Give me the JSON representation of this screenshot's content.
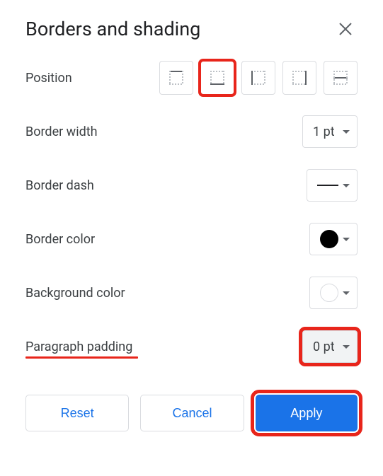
{
  "dialog": {
    "title": "Borders and shading"
  },
  "labels": {
    "position": "Position",
    "border_width": "Border width",
    "border_dash": "Border dash",
    "border_color": "Border color",
    "background_color": "Background color",
    "paragraph_padding": "Paragraph padding"
  },
  "position_options": [
    {
      "name": "top",
      "highlighted": false
    },
    {
      "name": "bottom",
      "highlighted": true
    },
    {
      "name": "left",
      "highlighted": false
    },
    {
      "name": "right",
      "highlighted": false
    },
    {
      "name": "between",
      "highlighted": false
    }
  ],
  "values": {
    "border_width": "1 pt",
    "border_dash": "solid",
    "border_color": "#000000",
    "background_color": "#ffffff",
    "paragraph_padding": "0 pt"
  },
  "buttons": {
    "reset": "Reset",
    "cancel": "Cancel",
    "apply": "Apply"
  },
  "annotations": {
    "highlighted_position_index": 1,
    "paragraph_padding_label_underlined": true,
    "paragraph_padding_select_highlighted": true,
    "apply_button_highlighted": true,
    "highlight_color": "#e8251b"
  }
}
